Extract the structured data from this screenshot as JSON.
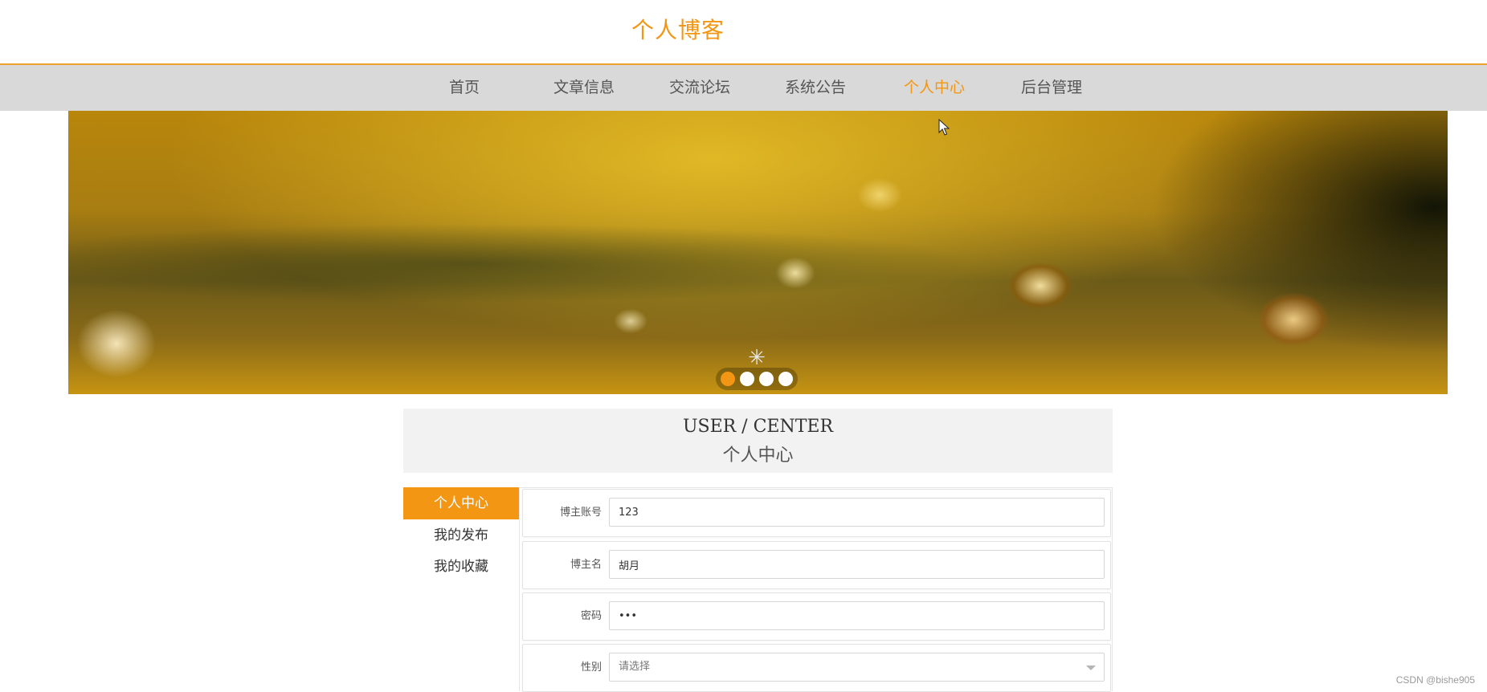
{
  "header": {
    "title": "个人博客"
  },
  "nav": {
    "items": [
      {
        "label": "首页"
      },
      {
        "label": "文章信息"
      },
      {
        "label": "交流论坛"
      },
      {
        "label": "系统公告"
      },
      {
        "label": "个人中心",
        "active": true
      },
      {
        "label": "后台管理"
      }
    ]
  },
  "banner": {
    "slide_count": 4,
    "active_slide": 1,
    "loading_icon": "spinner-icon"
  },
  "user_center": {
    "title_en": "USER / CENTER",
    "title_cn": "个人中心"
  },
  "sidebar": {
    "items": [
      {
        "label": "个人中心",
        "active": true
      },
      {
        "label": "我的发布"
      },
      {
        "label": "我的收藏"
      }
    ]
  },
  "form": {
    "account_label": "博主账号",
    "account_value": "123",
    "name_label": "博主名",
    "name_value": "胡月",
    "password_label": "密码",
    "password_value": "123",
    "gender_label": "性别",
    "gender_placeholder": "请选择"
  },
  "watermark": "CSDN @bishe905",
  "colors": {
    "accent": "#f29613",
    "nav_bg": "#d9d9d9",
    "header_panel_bg": "#f2f2f2"
  }
}
